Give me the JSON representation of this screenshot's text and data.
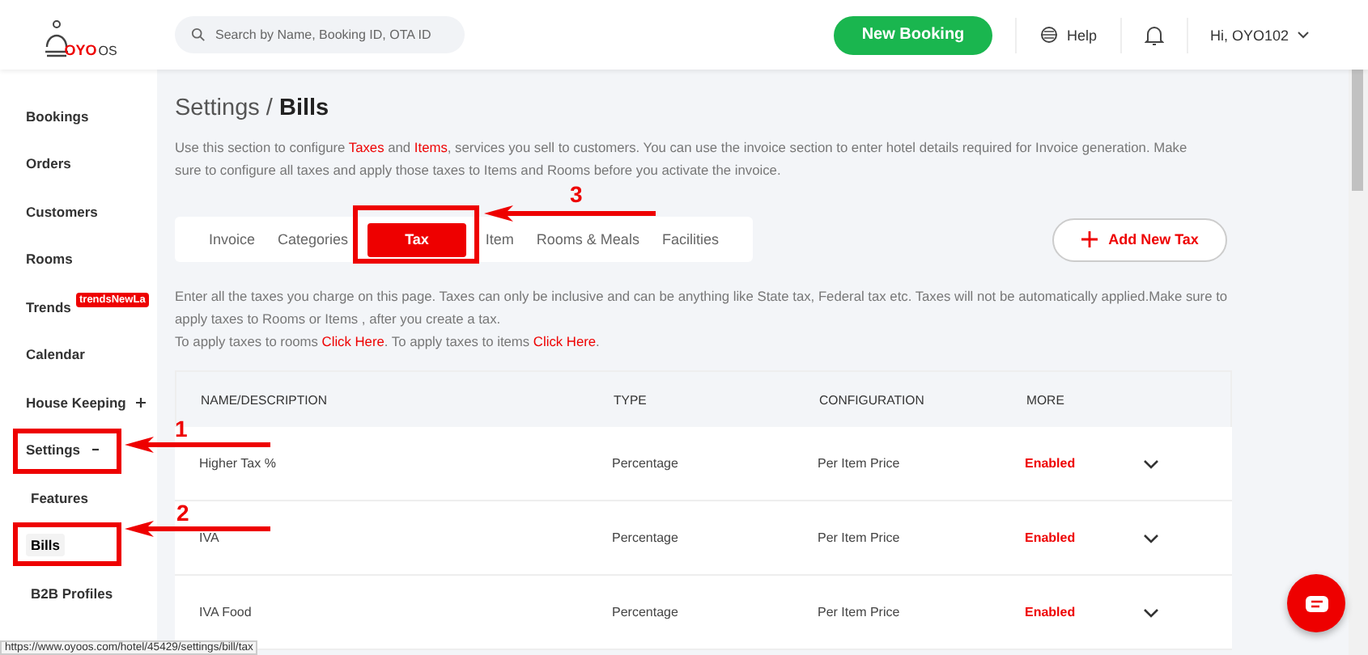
{
  "header": {
    "logo": {
      "brand": "OYO",
      "suffix": "OS"
    },
    "search": {
      "placeholder": "Search by Name, Booking ID, OTA ID"
    },
    "new_booking": "New Booking",
    "help": "Help",
    "user": "Hi, OYO102"
  },
  "sidebar": {
    "items": [
      {
        "label": "Bookings",
        "selected": false
      },
      {
        "label": "Orders",
        "selected": false
      },
      {
        "label": "Customers",
        "selected": false
      },
      {
        "label": "Rooms",
        "selected": false
      },
      {
        "label": "Trends",
        "selected": false,
        "badge": "trendsNewLa"
      },
      {
        "label": "Calendar",
        "selected": false
      },
      {
        "label": "House Keeping",
        "selected": false,
        "expanded": false
      },
      {
        "label": "Settings",
        "selected": false,
        "expanded": true,
        "children": [
          {
            "label": "Features",
            "selected": false
          },
          {
            "label": "Bills",
            "selected": true
          },
          {
            "label": "B2B Profiles",
            "selected": false
          }
        ]
      }
    ]
  },
  "page": {
    "breadcrumb": "Settings / ",
    "title": "Bills",
    "intro": "Use this section to configure **Taxes** and **Items**, services you sell to customers. You can use the invoice section to enter hotel details required for Invoice generation. Make sure to configure all taxes and apply those taxes to Items and Rooms before you activate the invoice.",
    "tabs": [
      {
        "label": "Invoice",
        "selected": false
      },
      {
        "label": "Categories",
        "selected": false
      },
      {
        "label": "Tax",
        "selected": true
      },
      {
        "label": "Item",
        "selected": false
      },
      {
        "label": "Rooms & Meals",
        "selected": false
      },
      {
        "label": "Facilities",
        "selected": false
      }
    ],
    "add_button": "Add New Tax",
    "note_lines": [
      "Enter all the taxes you charge on this page. Taxes can only be inclusive and can be anything like State tax, Federal tax etc. Taxes will not be automatically applied.Make sure to apply taxes to Rooms or Items , after you create a tax."
    ],
    "apply_line": [
      {
        "text": "To apply taxes to rooms "
      },
      {
        "link": "Click Here"
      },
      {
        "text": ". To apply taxes to items "
      },
      {
        "link": "Click Here"
      },
      {
        "text": "."
      }
    ],
    "table": {
      "columns": [
        "NAME/DESCRIPTION",
        "TYPE",
        "CONFIGURATION",
        "MORE"
      ],
      "rows": [
        {
          "name": "Higher Tax %",
          "type": "Percentage",
          "configuration": "Per Item Price",
          "status": "Enabled",
          "expanded": false
        },
        {
          "name": "IVA",
          "type": "Percentage",
          "configuration": "Per Item Price",
          "status": "Enabled",
          "expanded": false
        },
        {
          "name": "IVA Food",
          "type": "Percentage",
          "configuration": "Per Item Price",
          "status": "Enabled",
          "expanded": false
        }
      ]
    }
  },
  "annotations": [
    {
      "number": "1"
    },
    {
      "number": "2"
    },
    {
      "number": "3"
    }
  ],
  "status_url": "https://www.oyoos.com/hotel/45429/settings/bill/tax"
}
